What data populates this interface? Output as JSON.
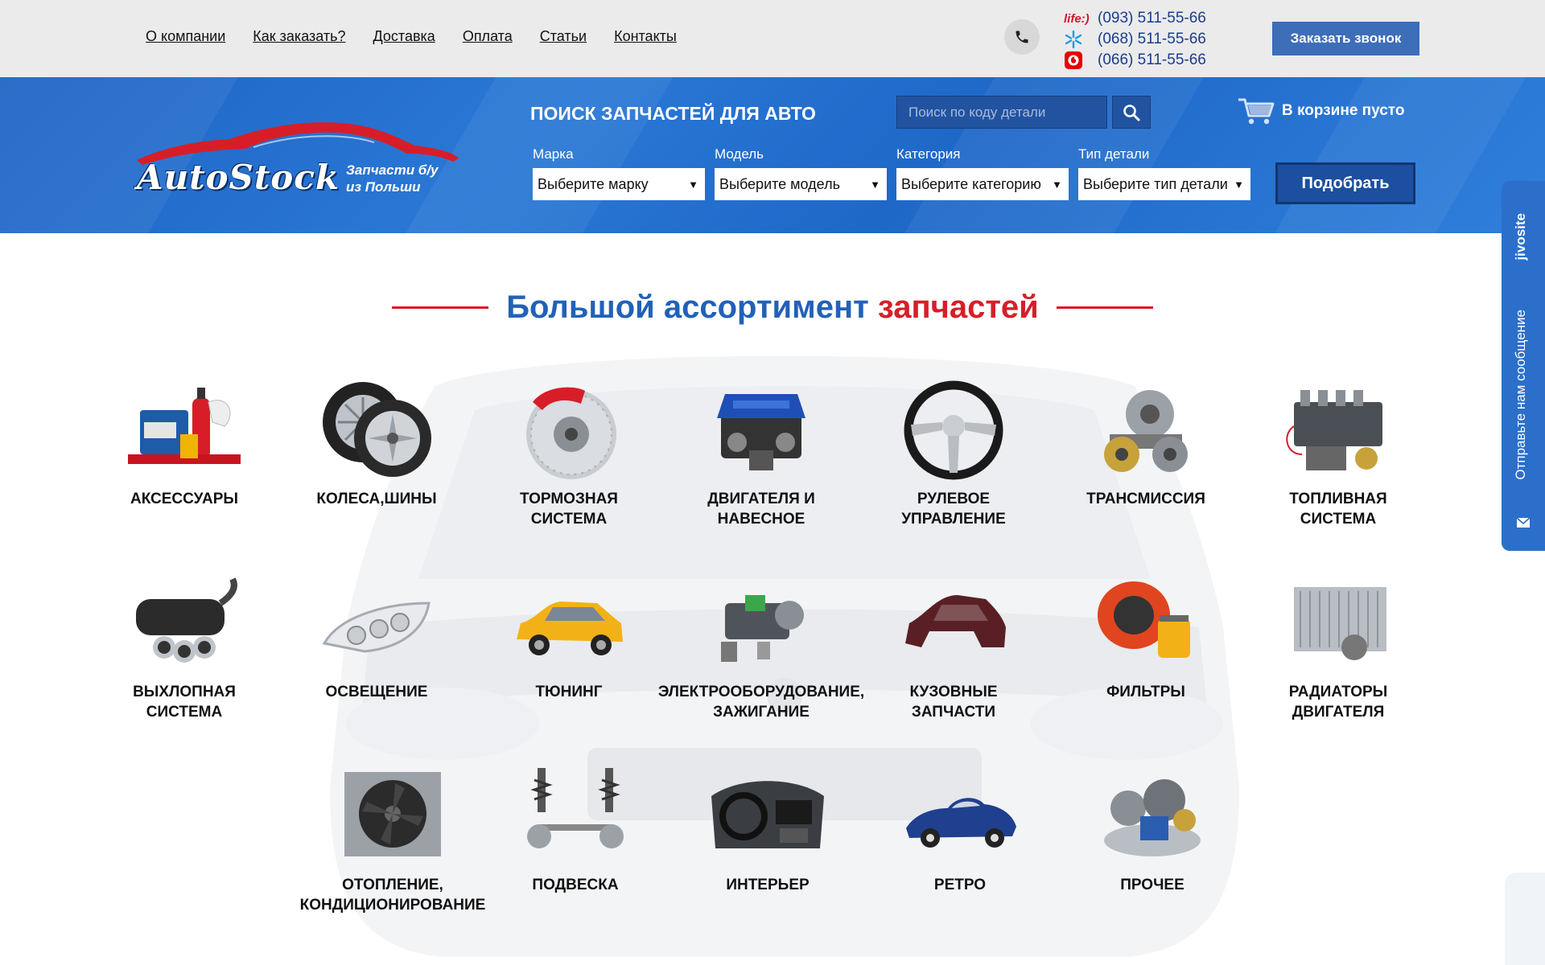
{
  "nav": {
    "items": [
      "О компании",
      "Как заказать?",
      "Доставка",
      "Оплата",
      "Статьи",
      "Контакты"
    ]
  },
  "contacts": {
    "phones": [
      {
        "operator": "life:)",
        "operator_icon": "life-logo-icon",
        "number": "(093) 511-55-66"
      },
      {
        "operator": "kyivstar",
        "operator_icon": "kyivstar-star-icon",
        "number": "(068) 511-55-66"
      },
      {
        "operator": "vodafone",
        "operator_icon": "vodafone-logo-icon",
        "number": "(066) 511-55-66"
      }
    ],
    "callback_label": "Заказать звонок"
  },
  "logo": {
    "brand": "AutoStock",
    "tagline_line1": "Запчасти б/у",
    "tagline_line2": "из Польши"
  },
  "search": {
    "title": "ПОИСК ЗАПЧАСТЕЙ ДЛЯ АВТО",
    "placeholder": "Поиск по коду детали"
  },
  "cart": {
    "label": "В корзине пусто"
  },
  "filters": {
    "brand_label": "Марка",
    "brand_value": "Выберите марку",
    "model_label": "Модель",
    "model_value": "Выберите модель",
    "category_label": "Категория",
    "category_value": "Выберите категорию",
    "type_label": "Тип детали",
    "type_value": "Выберите тип детали",
    "submit_label": "Подобрать"
  },
  "heading": {
    "blue": "Большой ассортимент",
    "red": "запчастей"
  },
  "categories": [
    {
      "line1": "АКСЕССУАРЫ",
      "line2": ""
    },
    {
      "line1": "КОЛЕСА,ШИНЫ",
      "line2": ""
    },
    {
      "line1": "ТОРМОЗНАЯ",
      "line2": "СИСТЕМА"
    },
    {
      "line1": "ДВИГАТЕЛЯ И",
      "line2": "НАВЕСНОЕ"
    },
    {
      "line1": "РУЛЕВОЕ",
      "line2": "УПРАВЛЕНИЕ"
    },
    {
      "line1": "ТРАНСМИССИЯ",
      "line2": ""
    },
    {
      "line1": "ТОПЛИВНАЯ",
      "line2": "СИСТЕМА"
    },
    {
      "line1": "ВЫХЛОПНАЯ",
      "line2": "СИСТЕМА"
    },
    {
      "line1": "ОСВЕЩЕНИЕ",
      "line2": ""
    },
    {
      "line1": "ТЮНИНГ",
      "line2": ""
    },
    {
      "line1": "ЭЛЕКТРООБОРУДОВАНИЕ,",
      "line2": "ЗАЖИГАНИЕ"
    },
    {
      "line1": "КУЗОВНЫЕ",
      "line2": "ЗАПЧАСТИ"
    },
    {
      "line1": "ФИЛЬТРЫ",
      "line2": ""
    },
    {
      "line1": "РАДИАТОРЫ",
      "line2": "ДВИГАТЕЛЯ"
    },
    {
      "line1": "ОТОПЛЕНИЕ,",
      "line2": "КОНДИЦИОНИРОВАНИЕ"
    },
    {
      "line1": "ПОДВЕСКА",
      "line2": ""
    },
    {
      "line1": "ИНТЕРЬЕР",
      "line2": ""
    },
    {
      "line1": "РЕТРО",
      "line2": ""
    },
    {
      "line1": "ПРОЧЕЕ",
      "line2": ""
    }
  ],
  "jivo": {
    "brand": "jivosite",
    "message": "Отправьте нам сообщение"
  },
  "colors": {
    "header_blue": "#2a78d6",
    "accent_red": "#d71e28",
    "heading_blue": "#2261b8",
    "button_blue": "#3d6eb8"
  }
}
